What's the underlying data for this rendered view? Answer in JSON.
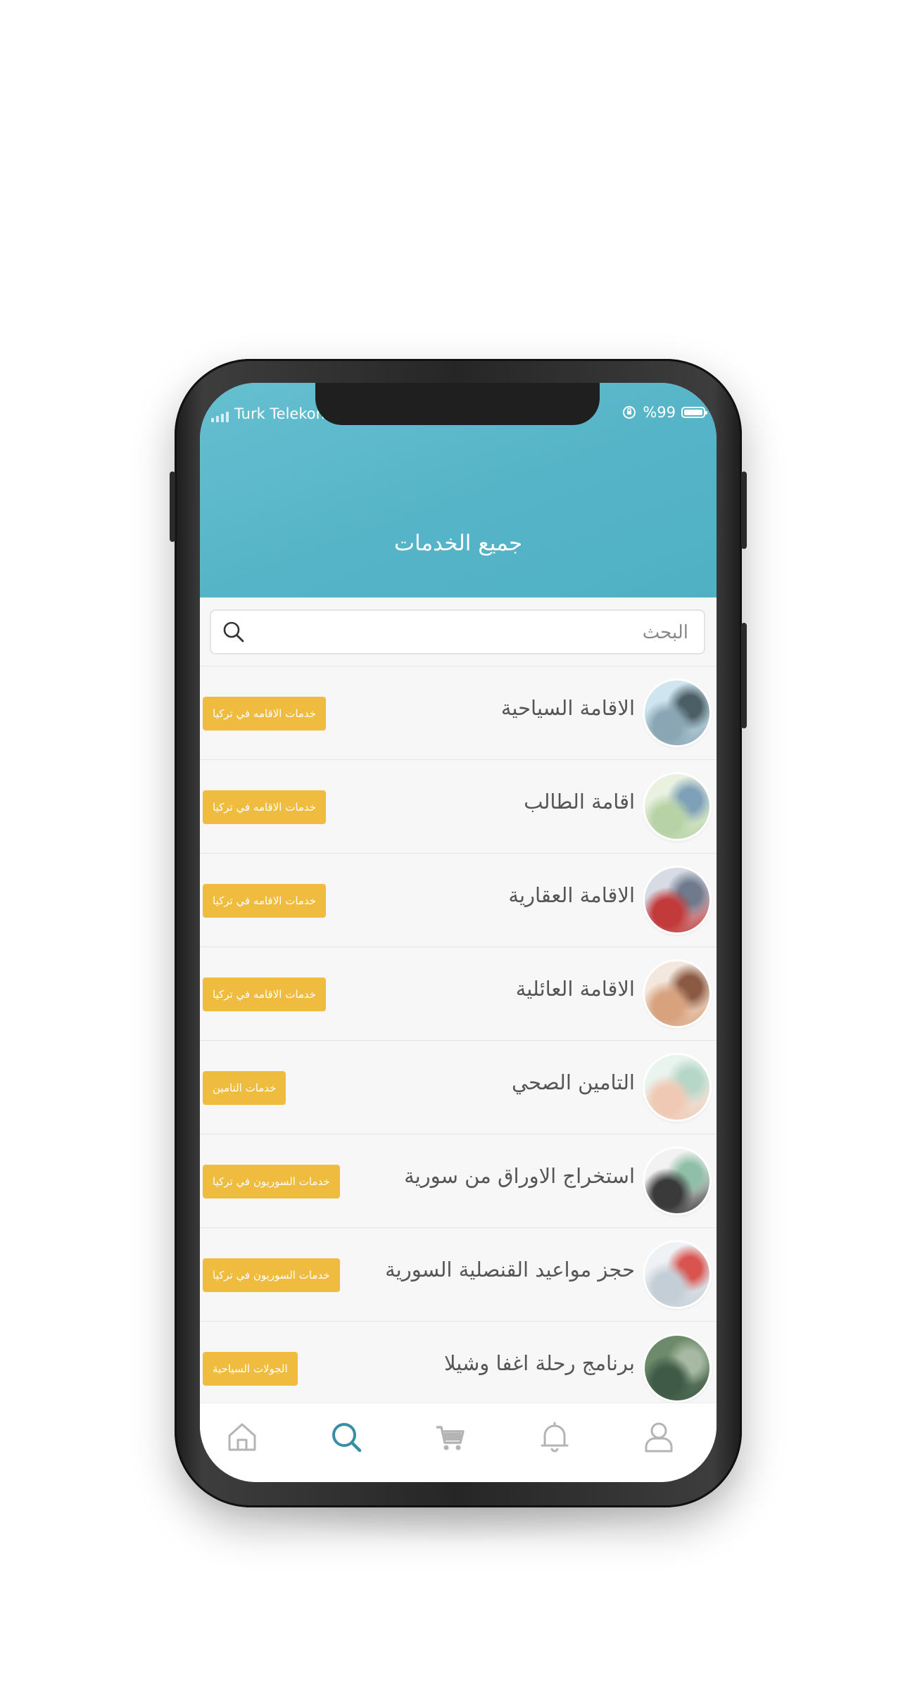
{
  "status_bar": {
    "carrier": "Turk Telekom",
    "battery_text": "%99"
  },
  "header": {
    "title": "جميع الخدمات"
  },
  "search": {
    "placeholder": "البحث"
  },
  "services": [
    {
      "title": "الاقامة السياحية",
      "tag": "خدمات الاقامه في تركيا",
      "thumb_colors": [
        "#cfe6f0",
        "#8aa6b4",
        "#4b5e66"
      ]
    },
    {
      "title": "اقامة الطالب",
      "tag": "خدمات الاقامه في تركيا",
      "thumb_colors": [
        "#e9f1e0",
        "#b7d3a6",
        "#7ea0b8"
      ]
    },
    {
      "title": "الاقامة العقارية",
      "tag": "خدمات الاقامه في تركيا",
      "thumb_colors": [
        "#d7dbe4",
        "#c33a3a",
        "#6f7a8c"
      ]
    },
    {
      "title": "الاقامة العائلية",
      "tag": "خدمات الاقامه في تركيا",
      "thumb_colors": [
        "#f4e8de",
        "#d9a27f",
        "#8a5a43"
      ]
    },
    {
      "title": "التامين الصحي",
      "tag": "خدمات التامين",
      "thumb_colors": [
        "#eaf4ef",
        "#f0c9b4",
        "#b6d6c8"
      ]
    },
    {
      "title": "استخراج الاوراق من سورية",
      "tag": "خدمات السوريون في تركيا",
      "thumb_colors": [
        "#f2f2f2",
        "#3a3a3a",
        "#8fbfa7"
      ]
    },
    {
      "title": "حجز مواعيد القنصلية السورية",
      "tag": "خدمات السوريون في تركيا",
      "thumb_colors": [
        "#eef2f5",
        "#c4ced6",
        "#d9534f"
      ]
    },
    {
      "title": "برنامج رحلة اغفا وشيلا",
      "tag": "الجولات السياحية",
      "thumb_colors": [
        "#6d8a6a",
        "#3f5a46",
        "#a7b9a3"
      ]
    }
  ],
  "tabbar": {
    "items": [
      {
        "icon": "home-icon",
        "active": false
      },
      {
        "icon": "search-icon",
        "active": true
      },
      {
        "icon": "cart-icon",
        "active": false
      },
      {
        "icon": "bell-icon",
        "active": false
      },
      {
        "icon": "user-icon",
        "active": false
      }
    ],
    "active_color": "#3a8ea3",
    "inactive_color": "#b4b4b4"
  },
  "colors": {
    "header": "#56b4c8",
    "tag": "#f0bc3f"
  }
}
